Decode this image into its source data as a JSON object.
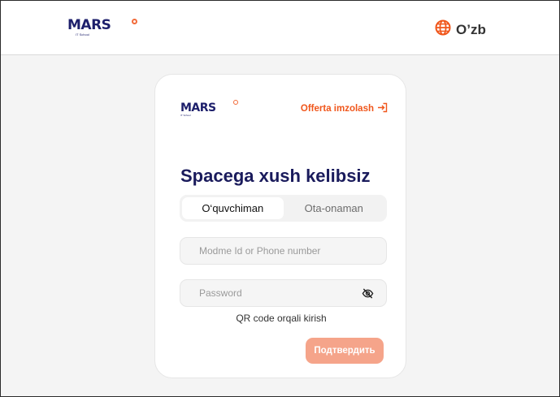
{
  "header": {
    "logo": {
      "word": "MARS",
      "subtitle": "IT School"
    },
    "language": {
      "label": "O’zb",
      "icon": "globe-icon",
      "color": "#f0561b"
    }
  },
  "card": {
    "logo": {
      "word": "MARS",
      "subtitle": "IT School"
    },
    "offerta": {
      "label": "Offerta imzolash",
      "icon": "sign-in-icon"
    },
    "title": "Spacega xush kelibsiz",
    "tabs": [
      {
        "label": "O‘quvchiman",
        "active": true
      },
      {
        "label": "Ota-onaman",
        "active": false
      }
    ],
    "login": {
      "placeholder": "Modme Id or Phone number",
      "value": ""
    },
    "password": {
      "placeholder": "Password",
      "value": "",
      "icon": "eye-off-icon"
    },
    "qr_link": "QR code orqali kirish",
    "submit_label": "Подтвердить"
  },
  "colors": {
    "brand_navy": "#1d1f6b",
    "accent_orange": "#f0561b",
    "button_disabled": "#f5a48a"
  }
}
